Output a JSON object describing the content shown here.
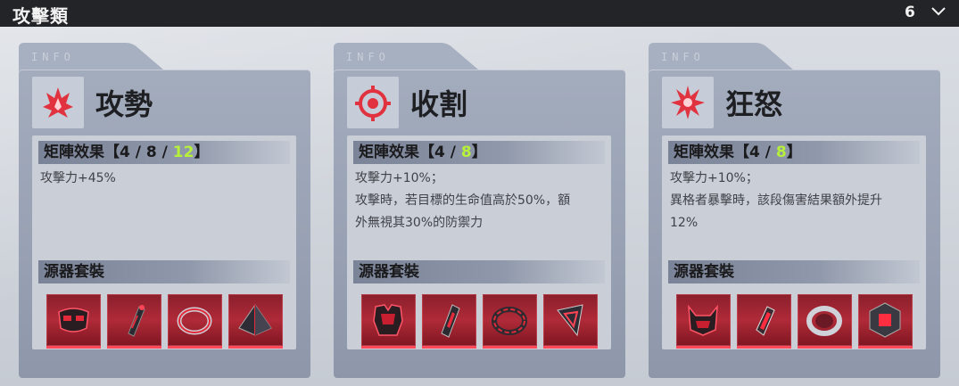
{
  "header": {
    "title": "攻擊類",
    "count": "6"
  },
  "colors": {
    "accent_red": "#e02c3c",
    "highlight_green": "#b7f03a",
    "panel": "#a3acbd",
    "topbar": "#232427"
  },
  "cards": [
    {
      "tab_label": "INFO",
      "icon": "flame-burst-icon",
      "name": "攻勢",
      "matrix": {
        "label": "矩陣效果",
        "open": "【",
        "l1": "4",
        "sep1": " / ",
        "l2": "8",
        "sep2": " / ",
        "l3": "12",
        "close": "】"
      },
      "desc": [
        "攻擊力+45%"
      ],
      "set_label": "源器套裝",
      "items": [
        "mask-icon",
        "cylinder-icon",
        "ring-icon",
        "pyramid-icon"
      ]
    },
    {
      "tab_label": "INFO",
      "icon": "crosshair-target-icon",
      "name": "收割",
      "matrix": {
        "label": "矩陣效果",
        "open": "【",
        "l1": "4",
        "sep1": " / ",
        "l2": "8",
        "close": "】"
      },
      "desc": [
        "攻擊力+10%；",
        "攻擊時，若目標的生命值高於50%，額",
        "外無視其30%的防禦力"
      ],
      "set_label": "源器套裝",
      "items": [
        "chest-armor-icon",
        "canister-icon",
        "ring-icon",
        "triangle-shard-icon"
      ]
    },
    {
      "tab_label": "INFO",
      "icon": "spiked-star-icon",
      "name": "狂怒",
      "matrix": {
        "label": "矩陣效果",
        "open": "【",
        "l1": "4",
        "sep1": " / ",
        "l2": "8",
        "close": "】"
      },
      "desc": [
        "攻擊力+10%；",
        "異格者暴擊時，該段傷害結果額外提升",
        "12%"
      ],
      "set_label": "源器套裝",
      "items": [
        "horned-helmet-icon",
        "vial-icon",
        "ring-icon",
        "cube-core-icon"
      ]
    }
  ]
}
